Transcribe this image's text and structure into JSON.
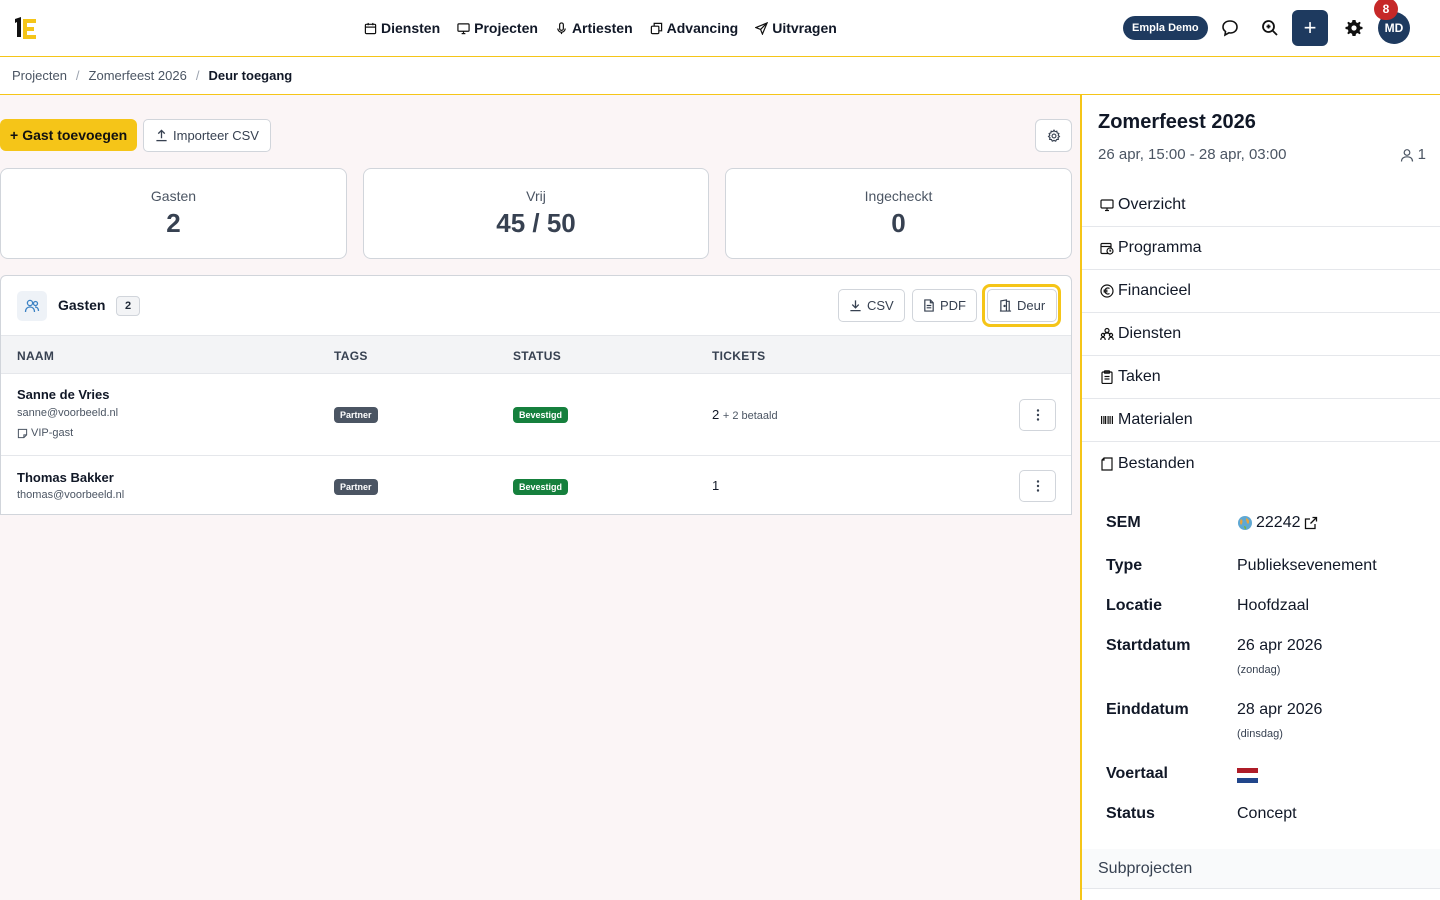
{
  "topbar": {
    "nav": [
      {
        "label": "Diensten",
        "icon": "calendar-icon"
      },
      {
        "label": "Projecten",
        "icon": "monitor-icon"
      },
      {
        "label": "Artiesten",
        "icon": "microphone-icon"
      },
      {
        "label": "Advancing",
        "icon": "copy-icon"
      },
      {
        "label": "Uitvragen",
        "icon": "send-icon"
      }
    ],
    "demo_badge": "Empla Demo",
    "notification_count": "8",
    "avatar_initials": "MD",
    "plus_label": "+"
  },
  "breadcrumb": {
    "items": [
      "Projecten",
      "Zomerfeest 2026"
    ],
    "current": "Deur toegang",
    "separator": "/"
  },
  "actions": {
    "add_guest": "Gast toevoegen",
    "add_guest_prefix": "+",
    "import_csv": "Importeer CSV"
  },
  "stats": [
    {
      "label": "Gasten",
      "value": "2"
    },
    {
      "label": "Vrij",
      "value": "45 / 50"
    },
    {
      "label": "Ingecheckt",
      "value": "0"
    }
  ],
  "guests_panel": {
    "title": "Gasten",
    "count": "2",
    "export_csv": "CSV",
    "export_pdf": "PDF",
    "door": "Deur",
    "columns": [
      "NAAM",
      "TAGS",
      "STATUS",
      "TICKETS"
    ],
    "rows": [
      {
        "name": "Sanne de Vries",
        "email": "sanne@voorbeeld.nl",
        "note": "VIP-gast",
        "tag": "Partner",
        "status": "Bevestigd",
        "tickets": "2",
        "tickets_extra": "+ 2 betaald"
      },
      {
        "name": "Thomas Bakker",
        "email": "thomas@voorbeeld.nl",
        "note": "",
        "tag": "Partner",
        "status": "Bevestigd",
        "tickets": "1",
        "tickets_extra": ""
      }
    ]
  },
  "sidebar": {
    "title": "Zomerfeest 2026",
    "dates": "26 apr, 15:00 - 28 apr, 03:00",
    "people_count": "1",
    "nav": [
      {
        "label": "Overzicht",
        "icon": "monitor-icon"
      },
      {
        "label": "Programma",
        "icon": "calendar-clock-icon"
      },
      {
        "label": "Financieel",
        "icon": "euro-icon"
      },
      {
        "label": "Diensten",
        "icon": "people-icon"
      },
      {
        "label": "Taken",
        "icon": "clipboard-icon"
      },
      {
        "label": "Materialen",
        "icon": "barcode-icon"
      },
      {
        "label": "Bestanden",
        "icon": "file-icon"
      }
    ],
    "details": {
      "sem_label": "SEM",
      "sem_value": "22242",
      "type_label": "Type",
      "type_value": "Publieksevenement",
      "locatie_label": "Locatie",
      "locatie_value": "Hoofdzaal",
      "start_label": "Startdatum",
      "start_value": "26 apr 2026",
      "start_day": "(zondag)",
      "end_label": "Einddatum",
      "end_value": "28 apr 2026",
      "end_day": "(dinsdag)",
      "voertaal_label": "Voertaal",
      "voertaal_flag": "flag-nl-icon",
      "status_label": "Status",
      "status_value": "Concept"
    },
    "subprojects": "Subprojecten"
  },
  "colors": {
    "accent": "#f5c518",
    "navy": "#1e3a5f",
    "confirmed": "#15803d",
    "tag": "#4b5563",
    "notification": "#c62828"
  }
}
